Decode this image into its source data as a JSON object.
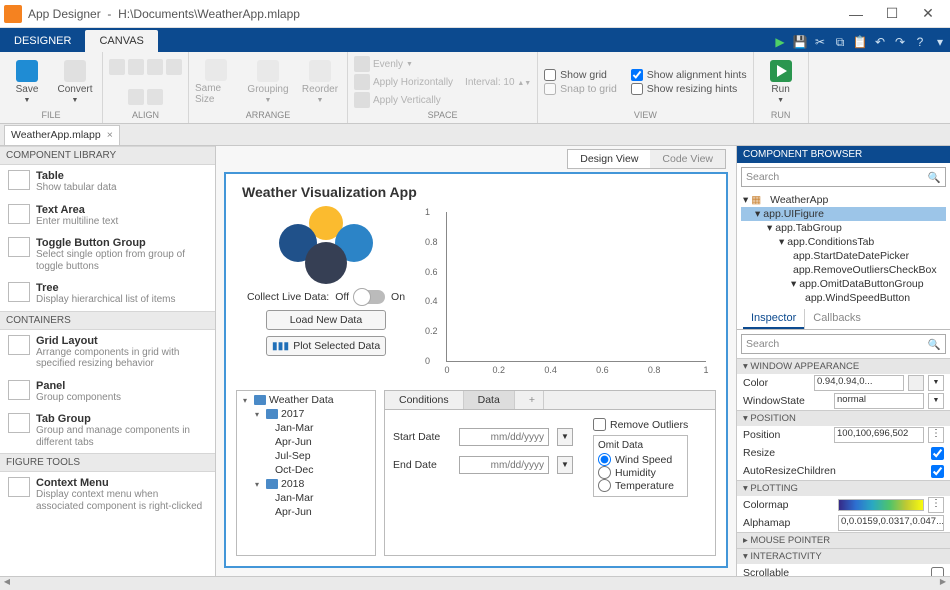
{
  "titlebar": {
    "app": "App Designer",
    "path": "H:\\Documents\\WeatherApp.mlapp"
  },
  "tabs": {
    "designer": "DESIGNER",
    "canvas": "CANVAS"
  },
  "ribbon": {
    "file": {
      "label": "FILE",
      "save": "Save",
      "convert": "Convert"
    },
    "align": {
      "label": "ALIGN"
    },
    "arrange": {
      "label": "ARRANGE",
      "same_size": "Same Size",
      "grouping": "Grouping",
      "reorder": "Reorder"
    },
    "space": {
      "label": "SPACE",
      "evenly": "Evenly",
      "apply_h": "Apply Horizontally",
      "apply_v": "Apply Vertically",
      "interval": "Interval:",
      "interval_val": "10"
    },
    "view": {
      "label": "VIEW",
      "show_grid": "Show grid",
      "snap": "Snap to grid",
      "hints": "Show alignment hints",
      "resizing": "Show resizing hints"
    },
    "run": {
      "label": "RUN",
      "run": "Run"
    }
  },
  "doctab": {
    "name": "WeatherApp.mlapp"
  },
  "library": {
    "hdr": "COMPONENT LIBRARY",
    "items": [
      {
        "title": "Table",
        "desc": "Show tabular data"
      },
      {
        "title": "Text Area",
        "desc": "Enter multiline text"
      },
      {
        "title": "Toggle Button Group",
        "desc": "Select single option from group of toggle buttons"
      },
      {
        "title": "Tree",
        "desc": "Display hierarchical list of items"
      }
    ],
    "containers_hdr": "CONTAINERS",
    "containers": [
      {
        "title": "Grid Layout",
        "desc": "Arrange components in grid with specified resizing behavior"
      },
      {
        "title": "Panel",
        "desc": "Group components"
      },
      {
        "title": "Tab Group",
        "desc": "Group and manage components in different tabs"
      }
    ],
    "tools_hdr": "FIGURE TOOLS",
    "tools": [
      {
        "title": "Context Menu",
        "desc": "Display context menu when associated component is right-clicked"
      }
    ]
  },
  "center": {
    "design": "Design View",
    "code": "Code View",
    "app_title": "Weather Visualization App",
    "collect": "Collect Live Data:",
    "off": "Off",
    "on": "On",
    "load": "Load New Data",
    "plot": "Plot Selected Data",
    "yticks": [
      "1",
      "0.8",
      "0.6",
      "0.4",
      "0.2",
      "0"
    ],
    "xticks": [
      "0",
      "0.2",
      "0.4",
      "0.6",
      "0.8",
      "1"
    ],
    "tree": {
      "root": "Weather Data",
      "y2017": "2017",
      "y2018": "2018",
      "q": [
        "Jan-Mar",
        "Apr-Jun",
        "Jul-Sep",
        "Oct-Dec"
      ]
    },
    "tabs": {
      "cond": "Conditions",
      "data": "Data"
    },
    "start": "Start Date",
    "end": "End Date",
    "date_ph": "mm/dd/yyyy",
    "remove": "Remove Outliers",
    "omit": "Omit Data",
    "opts": [
      "Wind Speed",
      "Humidity",
      "Temperature"
    ]
  },
  "browser": {
    "hdr": "COMPONENT BROWSER",
    "search": "Search",
    "nodes": {
      "root": "WeatherApp",
      "fig": "app.UIFigure",
      "tg": "app.TabGroup",
      "ct": "app.ConditionsTab",
      "sd": "app.StartDateDatePicker",
      "ro": "app.RemoveOutliersCheckBox",
      "od": "app.OmitDataButtonGroup",
      "ws": "app.WindSpeedButton"
    },
    "insp": "Inspector",
    "cb": "Callbacks",
    "sections": {
      "window": "WINDOW APPEARANCE",
      "position": "POSITION",
      "plotting": "PLOTTING",
      "mouse": "MOUSE POINTER",
      "interact": "INTERACTIVITY"
    },
    "props": {
      "color": "Color",
      "color_v": "0.94,0.94,0...",
      "winstate": "WindowState",
      "winstate_v": "normal",
      "pos": "Position",
      "pos_v": "100,100,696,502",
      "resize": "Resize",
      "arc": "AutoResizeChildren",
      "cmap": "Colormap",
      "amap": "Alphamap",
      "amap_v": "0,0.0159,0.0317,0.047...",
      "scroll": "Scrollable"
    }
  },
  "chart_data": {
    "type": "line",
    "x": [],
    "y": [],
    "xlabel": "",
    "ylabel": "",
    "xlim": [
      0,
      1
    ],
    "ylim": [
      0,
      1
    ],
    "xticks": [
      0,
      0.2,
      0.4,
      0.6,
      0.8,
      1
    ],
    "yticks": [
      0,
      0.2,
      0.4,
      0.6,
      0.8,
      1
    ],
    "note": "Empty axes; no data series drawn."
  }
}
